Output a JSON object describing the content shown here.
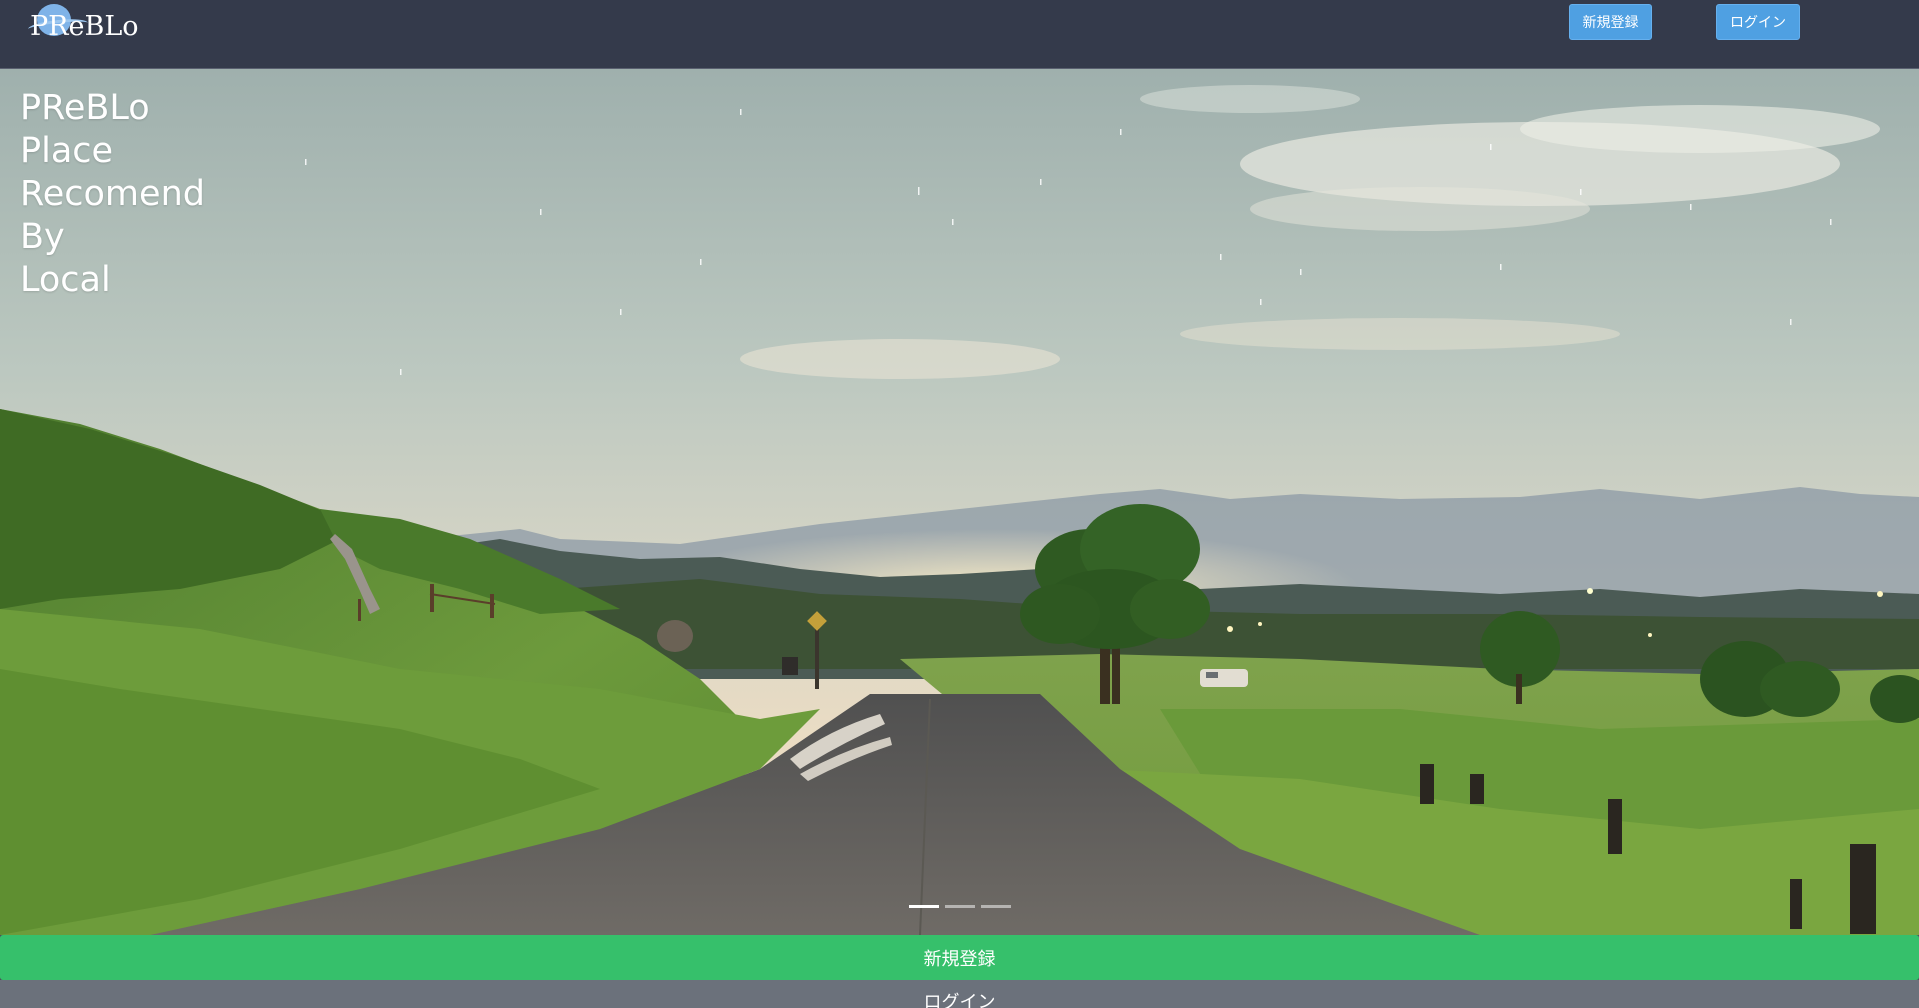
{
  "navbar": {
    "brand": "PReBLo",
    "register_label": "新規登録",
    "login_label": "ログイン"
  },
  "hero": {
    "tagline": [
      "PReBLo",
      "Place",
      "Recomend",
      "By",
      "Local"
    ],
    "image_description_icon": "landscape-photo",
    "slides_count": 3,
    "active_slide": 1
  },
  "actions": {
    "register_label": "新規登録",
    "login_label": "ログイン"
  },
  "colors": {
    "navbar_bg": "#343a4b",
    "nav_button": "#4fa0e2",
    "register_green": "#36c06b",
    "login_gray": "#6b717b"
  }
}
